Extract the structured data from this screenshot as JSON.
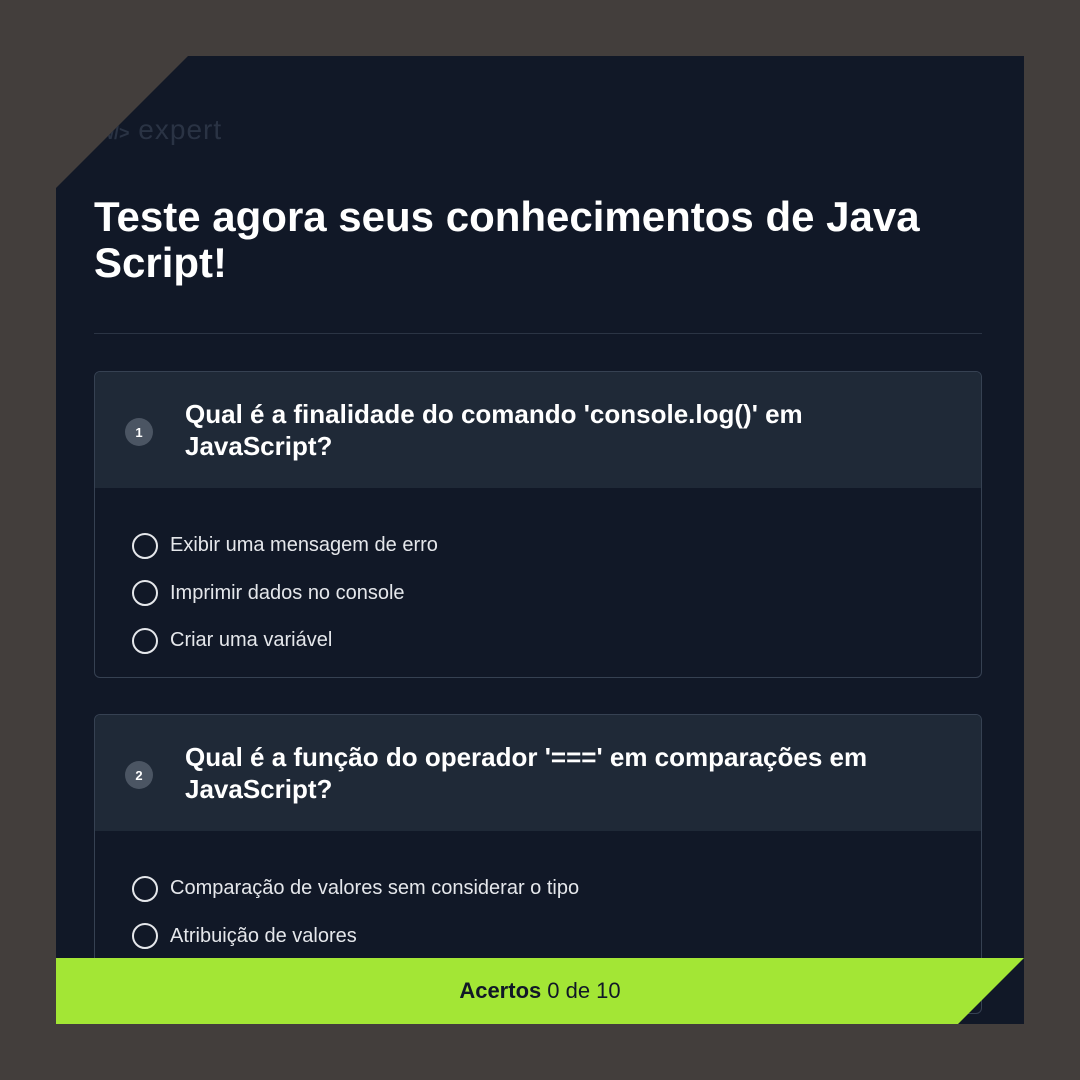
{
  "brand": {
    "prefix": "nlw/>",
    "name": "expert"
  },
  "page_title": "Teste agora seus conhecimentos de Java Script!",
  "questions": [
    {
      "number": "1",
      "text": "Qual é a finalidade do comando 'console.log()' em JavaScript?",
      "options": [
        "Exibir uma mensagem de erro",
        "Imprimir dados no console",
        "Criar uma variável"
      ]
    },
    {
      "number": "2",
      "text": "Qual é a função do operador '===' em comparações em JavaScript?",
      "options": [
        "Comparação de valores sem considerar o tipo",
        "Atribuição de valores"
      ]
    }
  ],
  "score": {
    "label": "Acertos",
    "value": "0 de 10"
  },
  "colors": {
    "background": "#111827",
    "card_header": "#1f2937",
    "accent": "#a3e635"
  }
}
